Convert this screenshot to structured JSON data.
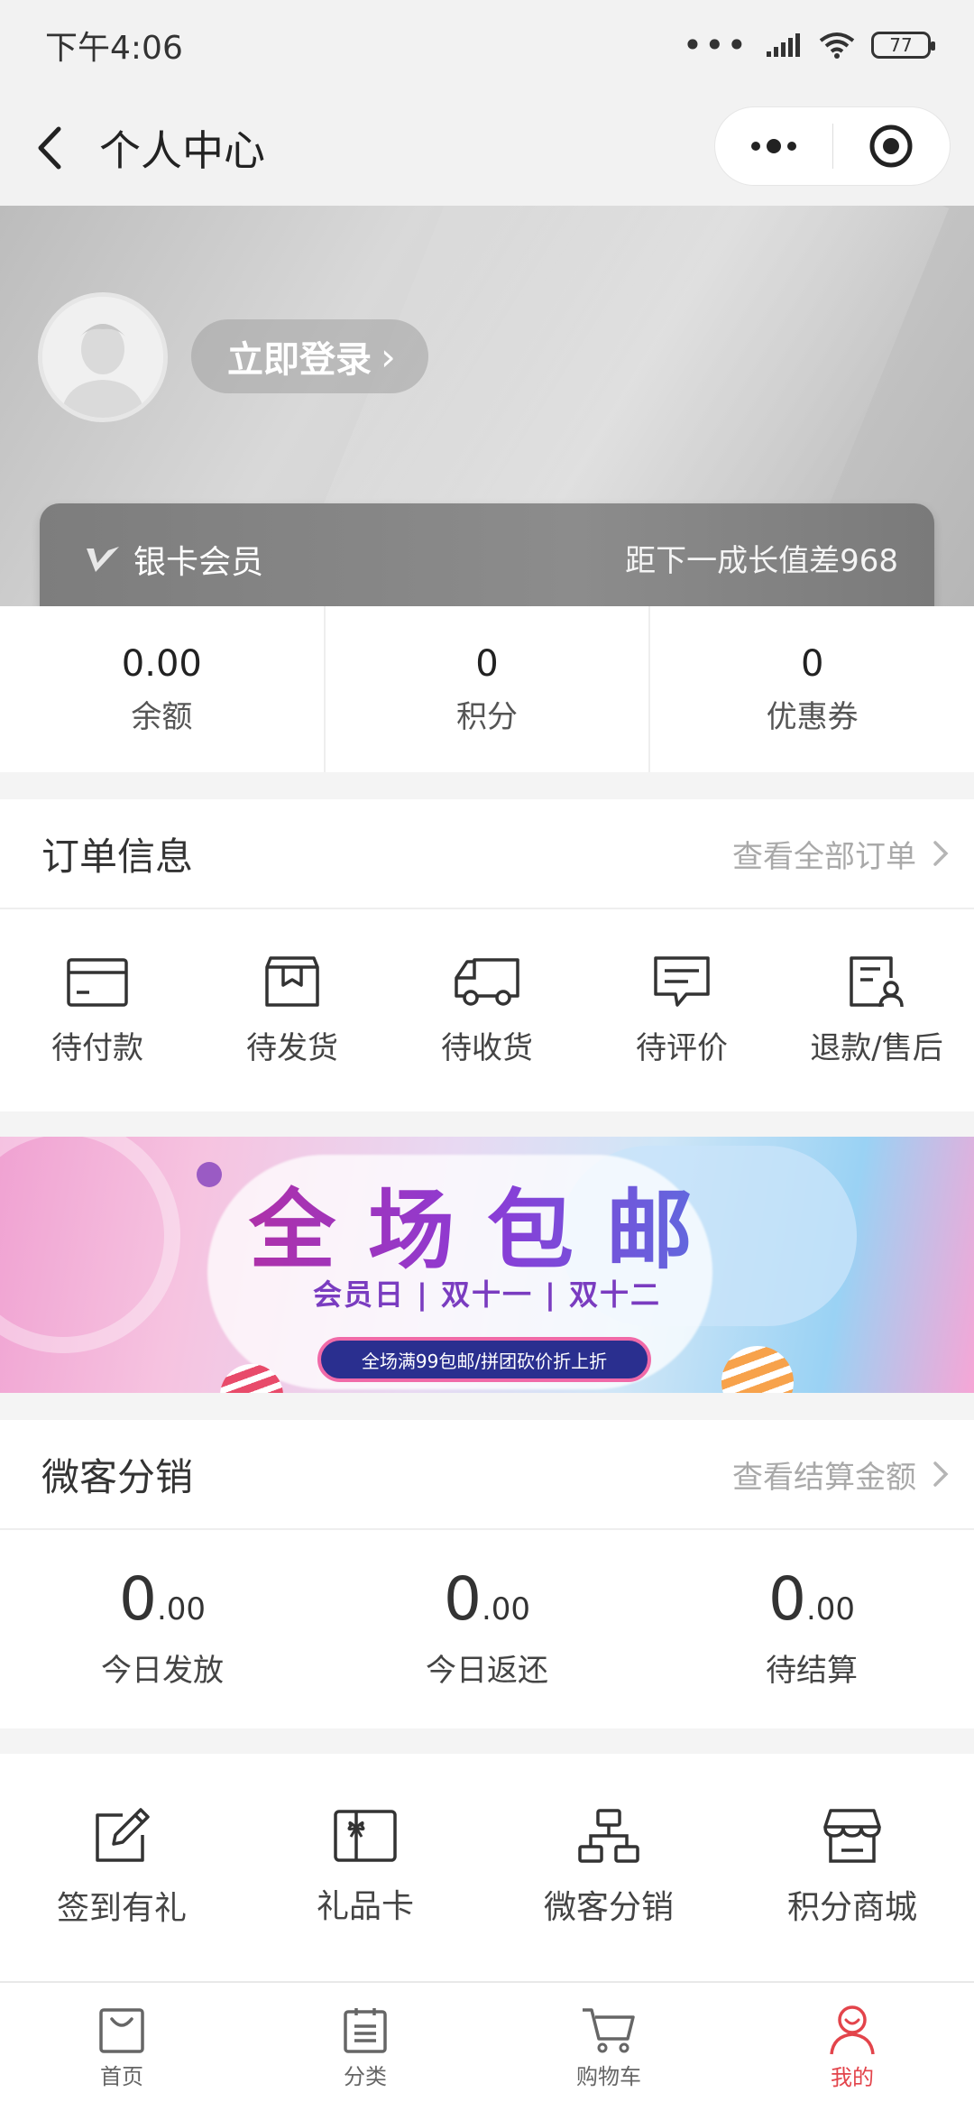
{
  "status_bar": {
    "time": "下午4:06",
    "dots": "•••",
    "battery": "77"
  },
  "nav": {
    "title": "个人中心",
    "capsule_more": "•••"
  },
  "profile": {
    "login_label": "立即登录",
    "chevron": "›",
    "member_level": "银卡会员",
    "growth_text": "距下一成长值差968"
  },
  "stats": [
    {
      "value": "0.00",
      "label": "余额"
    },
    {
      "value": "0",
      "label": "积分"
    },
    {
      "value": "0",
      "label": "优惠券"
    }
  ],
  "orders_section": {
    "title": "订单信息",
    "link": "查看全部订单"
  },
  "orders": [
    {
      "label": "待付款",
      "icon": "card-icon"
    },
    {
      "label": "待发货",
      "icon": "box-icon"
    },
    {
      "label": "待收货",
      "icon": "truck-icon"
    },
    {
      "label": "待评价",
      "icon": "comment-icon"
    },
    {
      "label": "退款/售后",
      "icon": "refund-icon"
    }
  ],
  "promo": {
    "title": "全场包邮",
    "subtitle": "会员日 | 双十一 | 双十二",
    "pill": "全场满99包邮/拼团砍价折上折"
  },
  "distribution_section": {
    "title": "微客分销",
    "link": "查看结算金额"
  },
  "distribution": [
    {
      "int": "0",
      "dec": ".00",
      "label": "今日发放"
    },
    {
      "int": "0",
      "dec": ".00",
      "label": "今日返还"
    },
    {
      "int": "0",
      "dec": ".00",
      "label": "待结算"
    }
  ],
  "shortcuts": [
    {
      "label": "签到有礼",
      "icon": "edit-icon"
    },
    {
      "label": "礼品卡",
      "icon": "gift-card-icon"
    },
    {
      "label": "微客分销",
      "icon": "org-chart-icon"
    },
    {
      "label": "积分商城",
      "icon": "store-icon"
    }
  ],
  "tabbar": [
    {
      "label": "首页",
      "icon": "bag-icon"
    },
    {
      "label": "分类",
      "icon": "list-icon"
    },
    {
      "label": "购物车",
      "icon": "cart-icon"
    },
    {
      "label": "我的",
      "icon": "user-icon",
      "active": true
    }
  ],
  "colors": {
    "accent": "#e3444b",
    "link_gray": "#a9a9a9"
  }
}
